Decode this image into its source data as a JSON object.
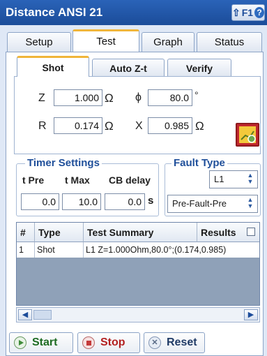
{
  "window": {
    "title": "Distance ANSI 21",
    "help_label": "F1"
  },
  "tabs": [
    "Setup",
    "Test",
    "Graph",
    "Status"
  ],
  "subtabs": [
    "Shot",
    "Auto Z-t",
    "Verify"
  ],
  "shot": {
    "z_label": "Z",
    "z_value": "1.000",
    "z_unit": "Ω",
    "phi_label": "ϕ",
    "phi_value": "80.0",
    "phi_unit": "°",
    "r_label": "R",
    "r_value": "0.174",
    "r_unit": "Ω",
    "x_label": "X",
    "x_value": "0.985",
    "x_unit": "Ω"
  },
  "timer": {
    "title": "Timer Settings",
    "headers": [
      "t Pre",
      "t Max",
      "CB delay"
    ],
    "values": [
      "0.0",
      "10.0",
      "0.0"
    ],
    "unit": "s"
  },
  "fault": {
    "title": "Fault Type",
    "phase": "L1",
    "mode": "Pre-Fault-Pre"
  },
  "table": {
    "headers": [
      "#",
      "Type",
      "Test Summary",
      "Results"
    ],
    "rows": [
      [
        "1",
        "Shot",
        "L1 Z=1.000Ohm,80.0°;(0.174,0.985)"
      ]
    ]
  },
  "buttons": {
    "start": "Start",
    "stop": "Stop",
    "reset": "Reset"
  },
  "colors": {
    "title_bar": "#1b4c99",
    "active_tab_accent": "#f0b53a",
    "graph_icon": "#c1272d"
  }
}
